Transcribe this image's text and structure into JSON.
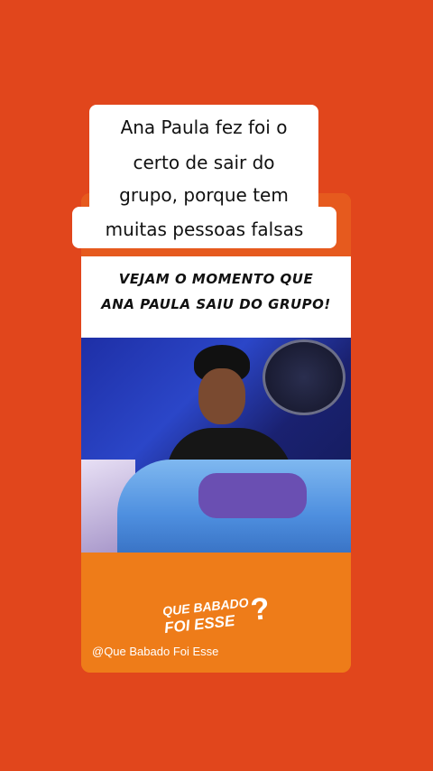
{
  "caption": {
    "lines": [
      "Ana Paula fez foi o",
      "certo de sair do",
      "grupo, porque tem",
      "muitas pessoas falsas"
    ]
  },
  "card": {
    "headline_line1": "VEJAM O MOMENTO QUE",
    "headline_line2": "ANA PAULA SAIU DO GRUPO!",
    "logo_line1": "QUE BABADO",
    "logo_line2": "FOI ESSE",
    "logo_mark": "?",
    "handle": "@Que Babado Foi Esse"
  },
  "colors": {
    "background": "#e1461c",
    "card_bottom": "#ee7c19",
    "caption_bg": "#ffffff"
  }
}
